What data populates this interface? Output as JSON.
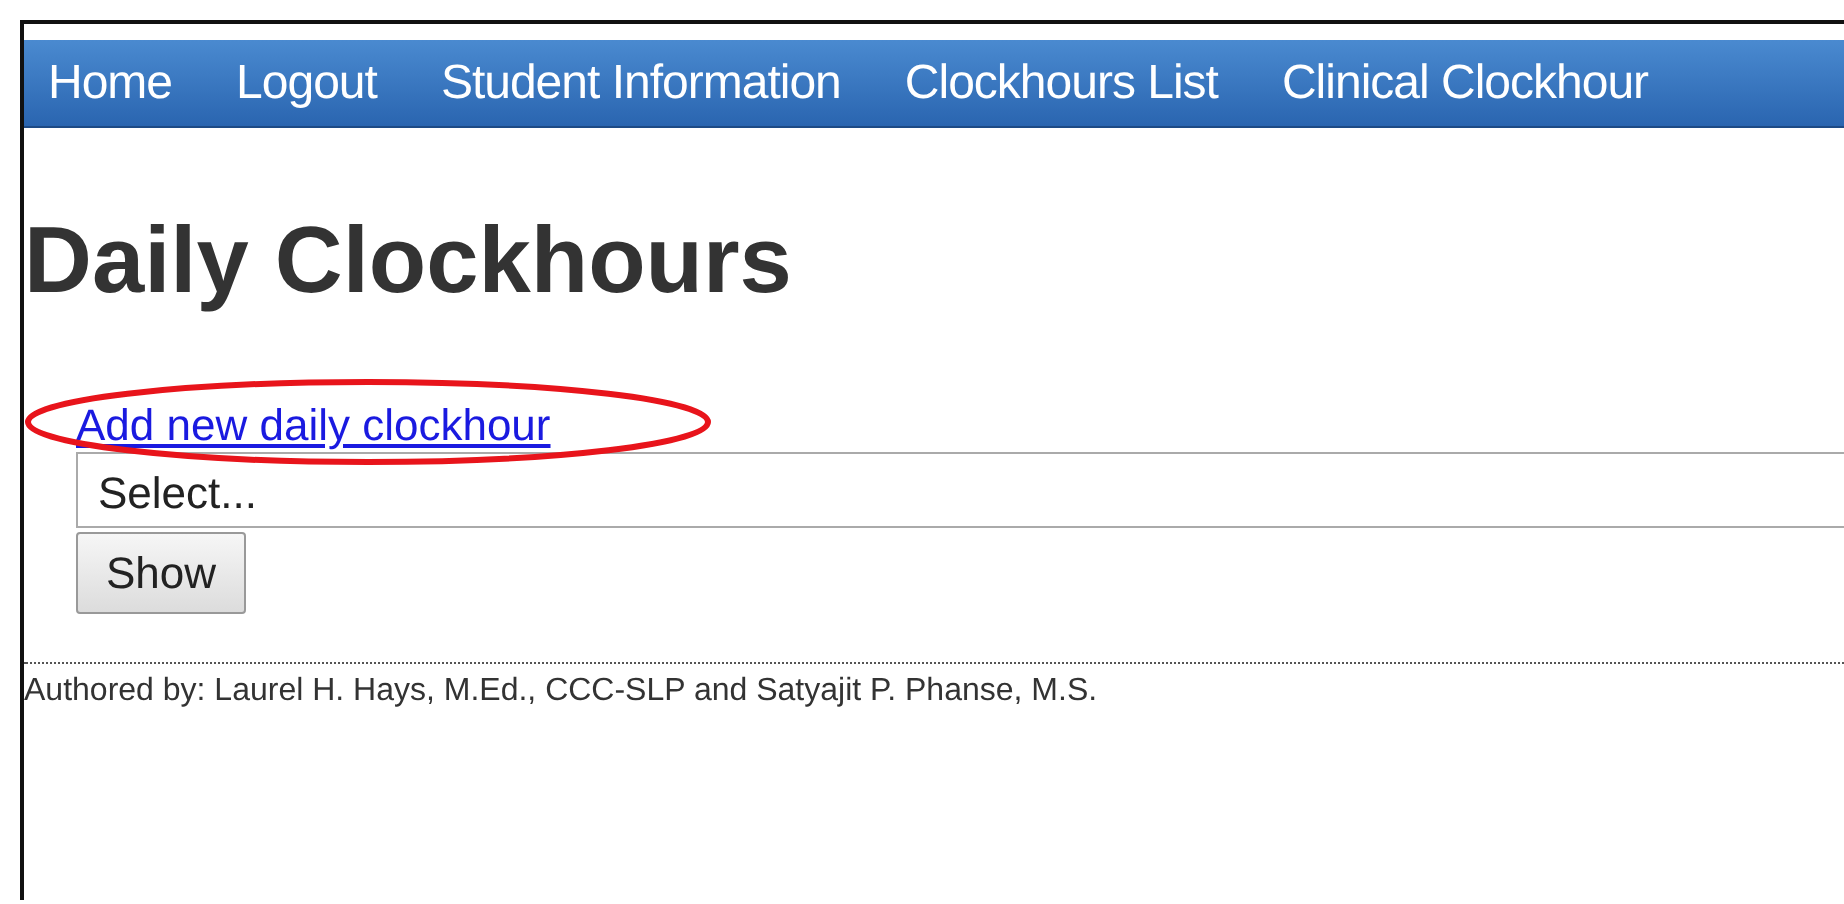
{
  "nav": {
    "items": [
      {
        "label": "Home"
      },
      {
        "label": "Logout"
      },
      {
        "label": "Student Information"
      },
      {
        "label": "Clockhours List"
      },
      {
        "label": "Clinical Clockhour"
      }
    ]
  },
  "heading": "Daily Clockhours",
  "add_link": "Add new daily clockhour",
  "filter": {
    "value": "Select...",
    "button": "Show"
  },
  "footer": "Authored by: Laurel H. Hays, M.Ed., CCC-SLP and Satyajit P. Phanse, M.S.",
  "annotation": {
    "kind": "ellipse",
    "color": "#e8141b"
  }
}
